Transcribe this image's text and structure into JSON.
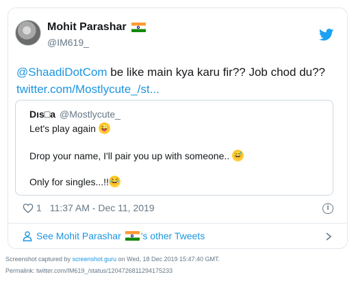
{
  "tweet": {
    "author_name": "Mohit Parashar",
    "author_handle": "@IM619_",
    "text_mention": "@ShaadiDotCom",
    "text_body": " be like main kya karu fir?? Job chod du??",
    "text_link": "twitter.com/Mostlycute_/st...",
    "quote": {
      "author_name": "Dıs□a",
      "author_handle": "@Mostlycute_",
      "line1": "Let's play again",
      "line2": "Drop your name, I'll pair you up with someone..",
      "line3": "Only for singles...!!",
      "emoji1": "wink-tongue-emoji",
      "emoji2": "sweat-smile-emoji",
      "emoji3": "tears-of-joy-emoji"
    },
    "like_count": "1",
    "timestamp": "11:37 AM - Dec 11, 2019",
    "see_more_prefix": "See Mohit Parashar",
    "see_more_suffix": "'s other Tweets",
    "flag_icon": "india-flag-icon"
  },
  "footer": {
    "captured_prefix": "Screenshot captured by ",
    "captured_link": "screenshot.guru",
    "captured_suffix": " on Wed, 18 Dec 2019 15:47:40 GMT.",
    "permalink": "Permalink: twitter.com/IM619_/status/1204726811294175233"
  },
  "colors": {
    "link": "#1b95e0",
    "muted": "#657786",
    "text": "#14171a",
    "border": "#e1e8ed"
  }
}
